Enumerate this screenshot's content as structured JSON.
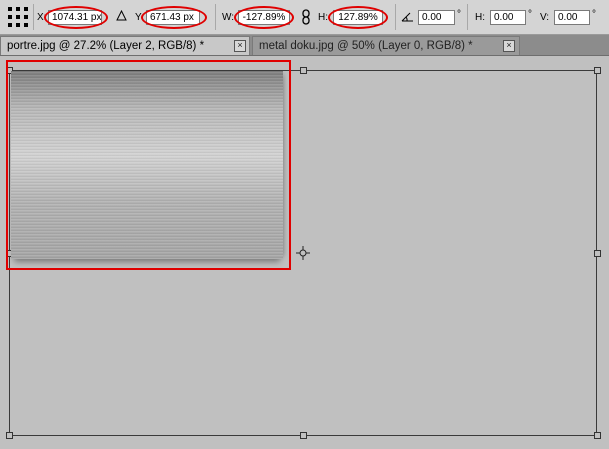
{
  "options_bar": {
    "x_label": "X:",
    "x_value": "1074.31 px",
    "y_label": "Y:",
    "y_value": "671.43 px",
    "w_label": "W:",
    "w_value": "-127.89%",
    "h_label": "H:",
    "h_value": "127.89%",
    "angle_value": "0.00",
    "angle_unit": "°",
    "hskew_label": "H:",
    "hskew_value": "0.00",
    "hskew_unit": "°",
    "vskew_label": "V:",
    "vskew_value": "0.00",
    "vskew_unit": "°"
  },
  "tabs": [
    {
      "label": "portre.jpg @ 27.2% (Layer 2, RGB/8) *",
      "active": true,
      "close": "×"
    },
    {
      "label": "metal doku.jpg @ 50% (Layer 0, RGB/8) *",
      "active": false,
      "close": "×"
    }
  ],
  "icons": {
    "reference_point": "reference-point-grid-icon",
    "delta_y": "delta-triangle-icon",
    "link": "chain-link-icon",
    "angle": "angle-icon",
    "pivot": "pivot-crosshair-icon"
  },
  "colors": {
    "highlight": "#e00000",
    "canvas": "#c0c0c0",
    "toolbar": "#d4d4d4"
  }
}
